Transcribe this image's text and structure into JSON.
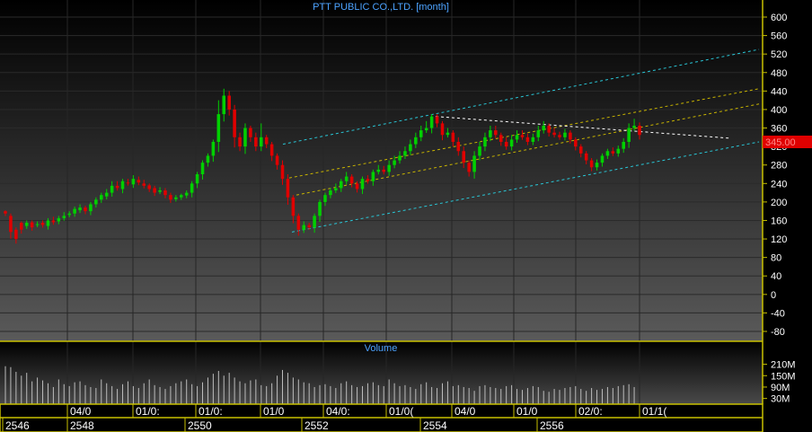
{
  "chart_data": {
    "type": "candlestick",
    "title": "PTT PUBLIC CO.,LTD. [month]",
    "timeframe": "month",
    "last_price": "345.00",
    "price_axis": {
      "ticks": [
        "600",
        "560",
        "520",
        "480",
        "440",
        "400",
        "360",
        "320",
        "280",
        "240",
        "200",
        "160",
        "120",
        "80",
        "40",
        "0",
        "-40",
        "-80"
      ],
      "range": [
        -100,
        620
      ]
    },
    "volume_panel": {
      "label": "Volume",
      "ticks": [
        "210M",
        "150M",
        "90M",
        "30M"
      ],
      "range": [
        0,
        260
      ],
      "unit": "M"
    },
    "x_axis_upper": [
      "04/0",
      "01/0:",
      "01/0:",
      "01/0",
      "04/0:",
      "01/0(",
      "04/0",
      "01/0",
      "02/0:",
      "01/1("
    ],
    "x_axis_lower": [
      "2546",
      "2548",
      "2550",
      "2552",
      "2554",
      "2556"
    ],
    "price_series": [
      [
        180,
        175,
        182
      ],
      [
        170,
        135,
        175
      ],
      [
        140,
        120,
        145
      ],
      [
        155,
        140,
        158
      ],
      [
        148,
        155,
        160
      ],
      [
        156,
        145,
        160
      ],
      [
        150,
        152,
        158
      ],
      [
        155,
        150,
        160
      ],
      [
        148,
        160,
        165
      ],
      [
        160,
        156,
        168
      ],
      [
        158,
        165,
        170
      ],
      [
        165,
        170,
        178
      ],
      [
        172,
        175,
        180
      ],
      [
        175,
        185,
        190
      ],
      [
        182,
        188,
        195
      ],
      [
        188,
        180,
        192
      ],
      [
        180,
        195,
        200
      ],
      [
        195,
        205,
        210
      ],
      [
        205,
        215,
        220
      ],
      [
        212,
        220,
        228
      ],
      [
        220,
        235,
        245
      ],
      [
        235,
        230,
        245
      ],
      [
        228,
        245,
        250
      ],
      [
        242,
        240,
        250
      ],
      [
        238,
        250,
        258
      ],
      [
        248,
        242,
        255
      ],
      [
        240,
        235,
        248
      ],
      [
        236,
        228,
        240
      ],
      [
        230,
        220,
        235
      ],
      [
        222,
        225,
        232
      ],
      [
        225,
        215,
        230
      ],
      [
        215,
        205,
        220
      ],
      [
        206,
        210,
        215
      ],
      [
        210,
        215,
        218
      ],
      [
        214,
        220,
        225
      ],
      [
        220,
        240,
        245
      ],
      [
        240,
        260,
        265
      ],
      [
        260,
        285,
        290
      ],
      [
        285,
        300,
        305
      ],
      [
        300,
        330,
        335
      ],
      [
        330,
        390,
        420
      ],
      [
        390,
        430,
        445
      ],
      [
        430,
        400,
        440
      ],
      [
        400,
        340,
        410
      ],
      [
        340,
        320,
        350
      ],
      [
        320,
        360,
        370
      ],
      [
        360,
        340,
        365
      ],
      [
        340,
        320,
        350
      ],
      [
        320,
        340,
        370
      ],
      [
        340,
        325,
        345
      ],
      [
        325,
        300,
        330
      ],
      [
        300,
        280,
        305
      ],
      [
        280,
        250,
        290
      ],
      [
        250,
        210,
        260
      ],
      [
        210,
        170,
        215
      ],
      [
        170,
        140,
        175
      ],
      [
        140,
        150,
        158
      ],
      [
        150,
        145,
        155
      ],
      [
        145,
        170,
        175
      ],
      [
        170,
        200,
        205
      ],
      [
        200,
        215,
        220
      ],
      [
        215,
        225,
        230
      ],
      [
        225,
        230,
        240
      ],
      [
        230,
        245,
        250
      ],
      [
        245,
        255,
        265
      ],
      [
        255,
        240,
        260
      ],
      [
        240,
        228,
        245
      ],
      [
        228,
        250,
        255
      ],
      [
        250,
        245,
        258
      ],
      [
        245,
        265,
        270
      ],
      [
        265,
        270,
        280
      ],
      [
        270,
        265,
        278
      ],
      [
        265,
        280,
        290
      ],
      [
        280,
        290,
        300
      ],
      [
        290,
        300,
        310
      ],
      [
        300,
        310,
        320
      ],
      [
        310,
        325,
        335
      ],
      [
        325,
        340,
        350
      ],
      [
        340,
        355,
        365
      ],
      [
        355,
        360,
        375
      ],
      [
        360,
        385,
        390
      ],
      [
        385,
        370,
        390
      ],
      [
        370,
        345,
        375
      ],
      [
        345,
        350,
        360
      ],
      [
        350,
        330,
        355
      ],
      [
        330,
        310,
        340
      ],
      [
        310,
        285,
        320
      ],
      [
        285,
        265,
        290
      ],
      [
        265,
        300,
        310
      ],
      [
        300,
        320,
        330
      ],
      [
        320,
        340,
        350
      ],
      [
        340,
        355,
        365
      ],
      [
        355,
        345,
        365
      ],
      [
        345,
        330,
        350
      ],
      [
        330,
        320,
        340
      ],
      [
        320,
        335,
        345
      ],
      [
        335,
        345,
        355
      ],
      [
        345,
        340,
        355
      ],
      [
        340,
        330,
        348
      ],
      [
        330,
        340,
        348
      ],
      [
        340,
        355,
        365
      ],
      [
        355,
        365,
        375
      ],
      [
        365,
        350,
        370
      ],
      [
        350,
        345,
        360
      ],
      [
        345,
        340,
        352
      ],
      [
        340,
        350,
        358
      ],
      [
        350,
        335,
        355
      ],
      [
        335,
        320,
        340
      ],
      [
        320,
        305,
        325
      ],
      [
        305,
        290,
        310
      ],
      [
        290,
        275,
        295
      ],
      [
        275,
        285,
        292
      ],
      [
        285,
        300,
        305
      ],
      [
        300,
        310,
        315
      ],
      [
        310,
        305,
        318
      ],
      [
        305,
        315,
        322
      ],
      [
        315,
        330,
        338
      ],
      [
        330,
        360,
        370
      ],
      [
        360,
        365,
        380
      ],
      [
        365,
        345,
        372
      ]
    ],
    "volume_series": [
      200,
      195,
      170,
      150,
      165,
      120,
      140,
      125,
      110,
      90,
      130,
      105,
      95,
      115,
      120,
      100,
      90,
      85,
      130,
      110,
      95,
      80,
      105,
      120,
      95,
      85,
      110,
      130,
      100,
      90,
      80,
      95,
      110,
      120,
      130,
      105,
      95,
      115,
      140,
      160,
      175,
      150,
      165,
      140,
      120,
      110,
      125,
      130,
      100,
      95,
      110,
      150,
      180,
      165,
      140,
      130,
      115,
      110,
      90,
      100,
      105,
      95,
      85,
      110,
      120,
      100,
      90,
      95,
      110,
      115,
      100,
      95,
      130,
      110,
      95,
      100,
      90,
      80,
      105,
      115,
      90,
      85,
      110,
      120,
      95,
      100,
      90,
      85,
      70,
      95,
      100,
      90,
      85,
      80,
      95,
      100,
      80,
      75,
      85,
      95,
      90,
      70,
      65,
      80,
      75,
      85,
      90,
      95,
      80,
      70,
      85,
      75,
      80,
      90,
      85,
      95,
      100,
      105,
      90
    ]
  }
}
